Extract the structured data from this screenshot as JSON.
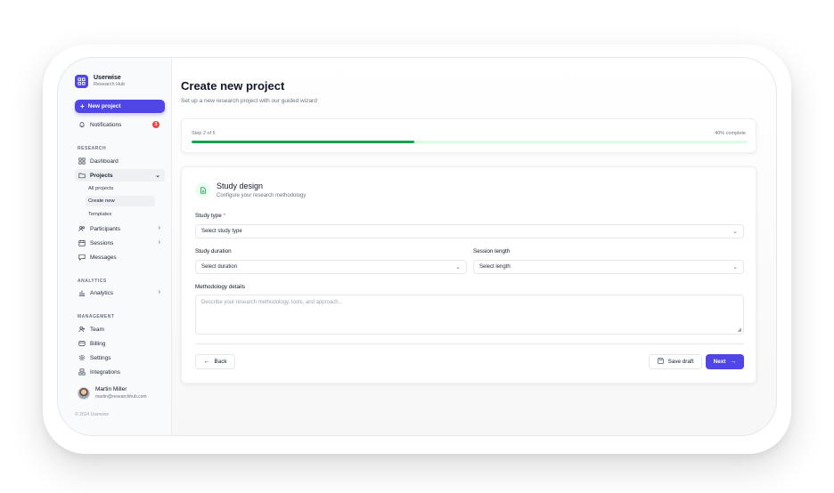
{
  "app": {
    "name": "Userwise",
    "subtitle": "Research Hub"
  },
  "sidebar": {
    "new_project": "New project",
    "notifications": {
      "label": "Notifications",
      "count": "3"
    },
    "sections": {
      "research": "RESEARCH",
      "analytics": "ANALYTICS",
      "management": "MANAGEMENT"
    },
    "items": {
      "dashboard": "Dashboard",
      "projects": "Projects",
      "participants": "Participants",
      "sessions": "Sessions",
      "messages": "Messages",
      "analytics": "Analytics",
      "team": "Team",
      "billing": "Billing",
      "settings": "Settings",
      "integrations": "Integrations"
    },
    "project_sub": [
      "All projects",
      "Create new",
      "Templates"
    ],
    "user": {
      "name": "Martin Miller",
      "email": "martin@researchhub.com"
    },
    "copyright": "© 2024 Userwise"
  },
  "page": {
    "title": "Create new project",
    "subtitle": "Set up a new research project with our guided wizard"
  },
  "progress": {
    "step_text": "Step 2 of 5",
    "percent_text": "40% complete",
    "value": 0.4
  },
  "form": {
    "section_title": "Study design",
    "section_subtitle": "Configure your research methodology",
    "study_type": {
      "label": "Study type",
      "required": "*",
      "value": "Select study type"
    },
    "study_duration": {
      "label": "Study duration",
      "value": "Select duration"
    },
    "session_length": {
      "label": "Session length",
      "value": "Select length"
    },
    "methodology": {
      "label": "Methodology details",
      "placeholder": "Describe your research methodology, tools, and approach..."
    },
    "back": "Back",
    "save_draft": "Save draft",
    "next": "Next"
  },
  "colors": {
    "accent": "#4f46e5",
    "progress": "#16a34a",
    "badge": "#ef4444"
  },
  "icons": [
    "grid-logo-icon",
    "plus-icon",
    "bell-icon",
    "dashboard-icon",
    "folder-icon",
    "users-icon",
    "calendar-icon",
    "message-icon",
    "bar-chart-icon",
    "team-icon",
    "card-icon",
    "gear-icon",
    "integrations-icon",
    "document-icon",
    "chevron-down-icon",
    "arrow-left-icon",
    "save-icon",
    "arrow-right-icon"
  ]
}
